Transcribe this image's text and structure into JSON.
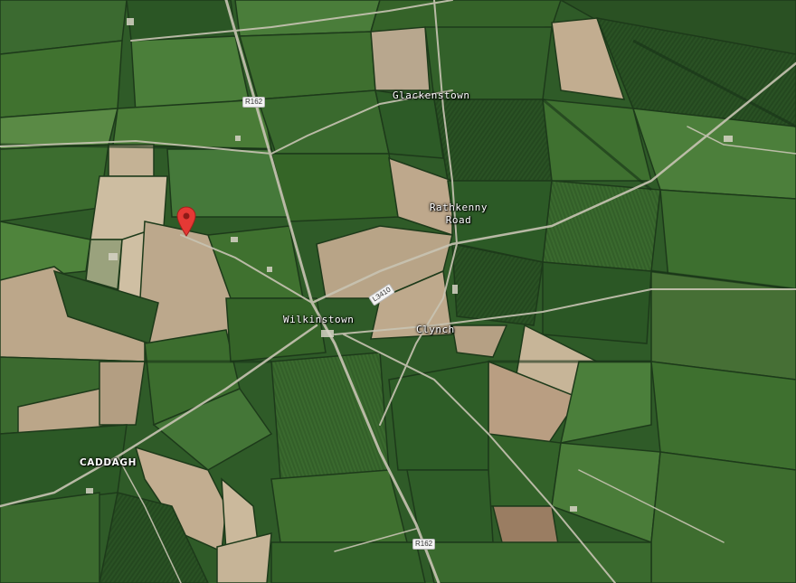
{
  "map": {
    "view": "satellite",
    "places": {
      "glackenstown": "Glackenstown",
      "rathkenny_line1": "Rathkenny",
      "rathkenny_line2": "Road",
      "wilkinstown": "Wilkinstown",
      "clynch": "Clynch",
      "caddagh": "CADDAGH"
    },
    "roads": {
      "r162_north": "R162",
      "r162_south": "R162",
      "l3410": "L3410"
    },
    "marker": {
      "icon": "map-pin-icon",
      "color": "#e53935"
    },
    "colors": {
      "field_dark": "#2c5a26",
      "field_mid": "#3d6e30",
      "field_light": "#5a8a44",
      "bare_soil": "#b9a38a",
      "road": "#c9c6b8"
    }
  }
}
